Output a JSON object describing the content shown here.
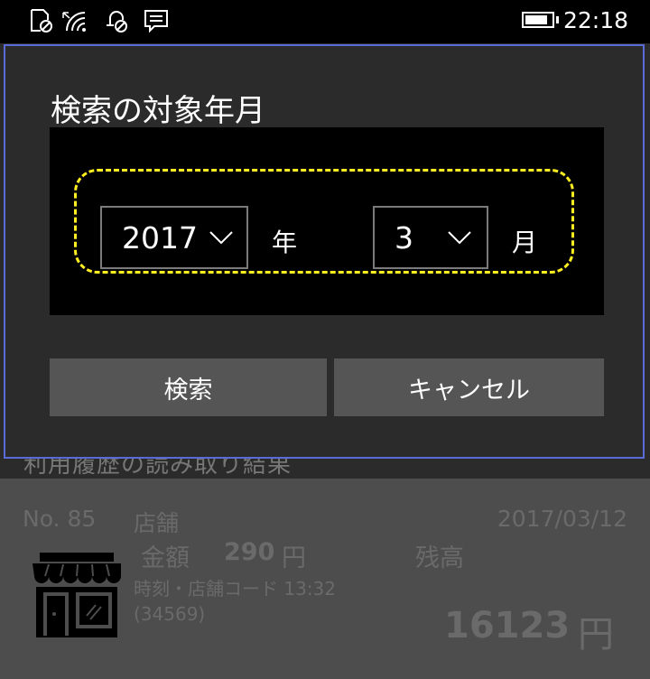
{
  "status_bar": {
    "time": "22:18",
    "battery_level": 0.85,
    "icons": [
      "calendar-off-icon",
      "wifi-icon",
      "alarm-off-icon",
      "notification-icon"
    ]
  },
  "background": {
    "history_title": "利用履歴の読み取り結果",
    "record": {
      "number": "No. 85",
      "store_label": "店舗",
      "date": "2017/03/12",
      "amount_label": "金額",
      "amount_value": "290",
      "amount_unit": "円",
      "balance_label": "残高",
      "time_code_label": "時刻・店舗コード 13:32",
      "store_code": "(34569)",
      "balance_value": "16123",
      "balance_unit": "円",
      "icon": "store-icon"
    }
  },
  "dialog": {
    "title": "検索の対象年月",
    "year_value": "2017",
    "year_unit": "年",
    "month_value": "3",
    "month_unit": "月",
    "search_button": "検索",
    "cancel_button": "キャンセル",
    "highlight_color": "#ffee20",
    "border_color": "#5a6ad6"
  }
}
